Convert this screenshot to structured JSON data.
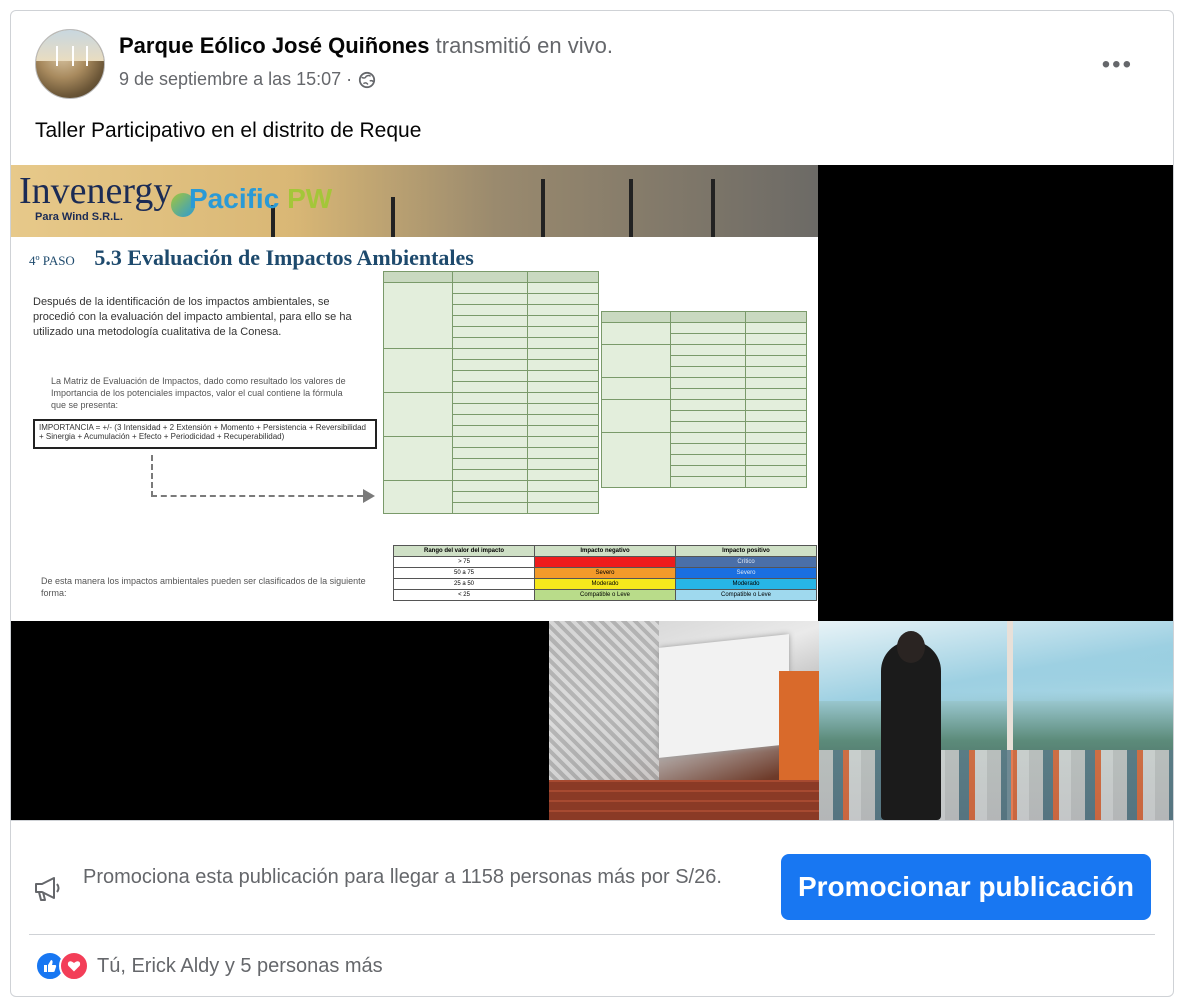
{
  "post": {
    "page_name": "Parque Eólico José Quiñones",
    "action": "transmitió en vivo.",
    "date": "9 de septiembre a las 15:07 ·",
    "privacy_icon": "globe-icon",
    "more_label": "•••",
    "text": "Taller Participativo en el distrito de Reque"
  },
  "slide": {
    "brand_main": "Invenergy",
    "brand_sub": "Para Wind S.R.L.",
    "brand_partner": "Pacific",
    "brand_partner_suffix": "PW",
    "step": "4º PASO",
    "heading": "5.3 Evaluación de Impactos Ambientales",
    "body": "Después de la identificación de los impactos ambientales, se procedió con la evaluación del impacto ambiental, para ello se ha utilizado una metodología cualitativa de la Conesa.",
    "body2": "La Matriz de Evaluación de Impactos, dado como resultado los valores de Importancia de los potenciales impactos, valor el cual contiene la fórmula que se presenta:",
    "formula": "IMPORTANCIA = +/- (3 Intensidad + 2 Extensión + Momento + Persistencia + Reversibilidad + Sinergia + Acumulación + Efecto + Periodicidad + Recuperabilidad)",
    "footer": "De esta manera los impactos ambientales pueden ser clasificados de la siguiente forma:",
    "legend_rows": [
      {
        "range": "Rango del valor del impacto",
        "neg": "Impacto negativo",
        "pos": "Impacto positivo"
      },
      {
        "range": "> 75",
        "neg": "Crítico",
        "pos": "Crítico"
      },
      {
        "range": "50 a 75",
        "neg": "Severo",
        "pos": "Severo"
      },
      {
        "range": "25 a 50",
        "neg": "Moderado",
        "pos": "Moderado"
      },
      {
        "range": "< 25",
        "neg": "Compatible o Leve",
        "pos": "Compatible o Leve"
      }
    ]
  },
  "promo": {
    "icon": "megaphone-icon",
    "text": "Promociona esta publicación para llegar a 1158 personas más por S/26.",
    "button": "Promocionar publicación"
  },
  "reactions": {
    "icons": [
      "like-icon",
      "love-icon"
    ],
    "text": "Tú, Erick Aldy y 5 personas más"
  },
  "colors": {
    "accent": "#1877f2",
    "secondary_text": "#65676b",
    "love": "#f33e58"
  }
}
